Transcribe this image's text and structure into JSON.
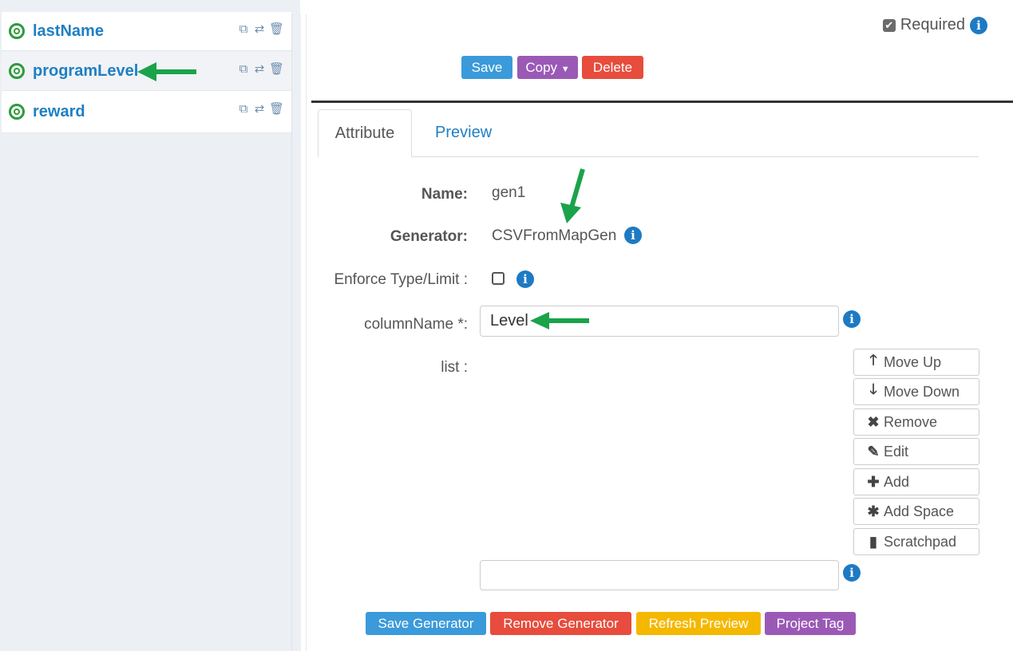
{
  "sidebar": {
    "items": [
      {
        "label": "lastName"
      },
      {
        "label": "programLevel"
      },
      {
        "label": "reward"
      }
    ]
  },
  "header": {
    "required_label": "Required",
    "save": "Save",
    "copy": "Copy",
    "delete": "Delete"
  },
  "tabs": [
    {
      "label": "Attribute"
    },
    {
      "label": "Preview"
    }
  ],
  "form": {
    "name_label": "Name:",
    "name_value": "gen1",
    "generator_label": "Generator:",
    "generator_value": "CSVFromMapGen",
    "enforce_label": "Enforce Type/Limit :",
    "column_label": "columnName *:",
    "column_value": "Level",
    "list_label": "list :",
    "list_input_value": ""
  },
  "list_buttons": [
    {
      "label": "Move Up",
      "icon": "arrow-up-icon"
    },
    {
      "label": "Move Down",
      "icon": "arrow-down-icon"
    },
    {
      "label": "Remove",
      "icon": "x-icon"
    },
    {
      "label": "Edit",
      "icon": "pencil-icon"
    },
    {
      "label": "Add",
      "icon": "plus-icon"
    },
    {
      "label": "Add Space",
      "icon": "asterisk-icon"
    },
    {
      "label": "Scratchpad",
      "icon": "file-icon"
    }
  ],
  "footer": {
    "save_generator": "Save Generator",
    "remove_generator": "Remove Generator",
    "refresh_preview": "Refresh Preview",
    "project_tag": "Project Tag"
  },
  "colors": {
    "primary": "#3498db",
    "purple": "#9b59b6",
    "danger": "#e74c3c",
    "warning": "#f5b800",
    "link": "#1f7fc4",
    "annotation_arrow": "#1aa34a"
  }
}
